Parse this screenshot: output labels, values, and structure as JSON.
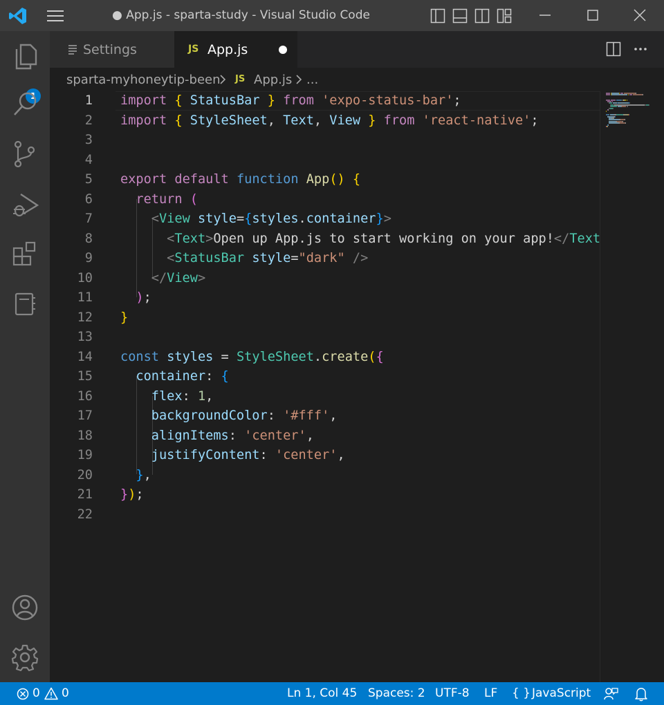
{
  "window": {
    "title": "● App.js - sparta-study - Visual Studio Code"
  },
  "activity_bar": {
    "explorer_badge": "1",
    "items": [
      "explorer",
      "search",
      "source-control",
      "run-debug",
      "extensions",
      "notebook"
    ],
    "bottom_items": [
      "accounts",
      "manage"
    ]
  },
  "tabs": [
    {
      "label": "Settings",
      "icon": "settings-file-icon",
      "active": false
    },
    {
      "label": "App.js",
      "icon": "JS",
      "active": true,
      "dirty": true
    }
  ],
  "breadcrumb": {
    "folder": "sparta-myhoneytip-been",
    "file_icon": "JS",
    "file": "App.js",
    "symbol": "..."
  },
  "editor": {
    "active_line": 1,
    "lines": [
      [
        [
          "import",
          "kw-pink"
        ],
        [
          " ",
          "pl"
        ],
        [
          "{",
          "b1"
        ],
        [
          " StatusBar ",
          "var"
        ],
        [
          "}",
          "b1"
        ],
        [
          " ",
          "pl"
        ],
        [
          "from",
          "kw-pink"
        ],
        [
          " ",
          "pl"
        ],
        [
          "'expo-status-bar'",
          "str"
        ],
        [
          ";",
          "pl"
        ]
      ],
      [
        [
          "import",
          "kw-pink"
        ],
        [
          " ",
          "pl"
        ],
        [
          "{",
          "b1"
        ],
        [
          " StyleSheet",
          "var"
        ],
        [
          ", ",
          "pl"
        ],
        [
          "Text",
          "var"
        ],
        [
          ", ",
          "pl"
        ],
        [
          "View",
          "var"
        ],
        [
          " ",
          "pl"
        ],
        [
          "}",
          "b1"
        ],
        [
          " ",
          "pl"
        ],
        [
          "from",
          "kw-pink"
        ],
        [
          " ",
          "pl"
        ],
        [
          "'react-native'",
          "str"
        ],
        [
          ";",
          "pl"
        ]
      ],
      [],
      [],
      [
        [
          "export",
          "kw-pink"
        ],
        [
          " ",
          "pl"
        ],
        [
          "default",
          "kw-pink"
        ],
        [
          " ",
          "pl"
        ],
        [
          "function",
          "kw-blue"
        ],
        [
          " ",
          "pl"
        ],
        [
          "App",
          "fn"
        ],
        [
          "()",
          "b1"
        ],
        [
          " ",
          "pl"
        ],
        [
          "{",
          "b1"
        ]
      ],
      [
        [
          "  ",
          "pl"
        ],
        [
          "return",
          "kw-pink"
        ],
        [
          " ",
          "pl"
        ],
        [
          "(",
          "b2"
        ]
      ],
      [
        [
          "    ",
          "pl"
        ],
        [
          "<",
          "tagp"
        ],
        [
          "View",
          "cls"
        ],
        [
          " ",
          "pl"
        ],
        [
          "style",
          "var"
        ],
        [
          "=",
          "pl"
        ],
        [
          "{",
          "b3"
        ],
        [
          "styles",
          "var"
        ],
        [
          ".",
          "pl"
        ],
        [
          "container",
          "var"
        ],
        [
          "}",
          "b3"
        ],
        [
          ">",
          "tagp"
        ]
      ],
      [
        [
          "      ",
          "pl"
        ],
        [
          "<",
          "tagp"
        ],
        [
          "Text",
          "cls"
        ],
        [
          ">",
          "tagp"
        ],
        [
          "Open up App.js to start working on your app!",
          "pl"
        ],
        [
          "</",
          "tagp"
        ],
        [
          "Text",
          "cls"
        ],
        [
          ">",
          "tagp"
        ]
      ],
      [
        [
          "      ",
          "pl"
        ],
        [
          "<",
          "tagp"
        ],
        [
          "StatusBar",
          "cls"
        ],
        [
          " ",
          "pl"
        ],
        [
          "style",
          "var"
        ],
        [
          "=",
          "pl"
        ],
        [
          "\"dark\"",
          "str"
        ],
        [
          " ",
          "pl"
        ],
        [
          "/>",
          "tagp"
        ]
      ],
      [
        [
          "    ",
          "pl"
        ],
        [
          "</",
          "tagp"
        ],
        [
          "View",
          "cls"
        ],
        [
          ">",
          "tagp"
        ]
      ],
      [
        [
          "  ",
          "pl"
        ],
        [
          ")",
          "b2"
        ],
        [
          ";",
          "pl"
        ]
      ],
      [
        [
          "}",
          "b1"
        ]
      ],
      [],
      [
        [
          "const",
          "kw-blue"
        ],
        [
          " ",
          "pl"
        ],
        [
          "styles",
          "var"
        ],
        [
          " = ",
          "pl"
        ],
        [
          "StyleSheet",
          "cls"
        ],
        [
          ".",
          "pl"
        ],
        [
          "create",
          "fn"
        ],
        [
          "(",
          "b1"
        ],
        [
          "{",
          "b2"
        ]
      ],
      [
        [
          "  ",
          "pl"
        ],
        [
          "container",
          "var"
        ],
        [
          ": ",
          "pl"
        ],
        [
          "{",
          "b3"
        ]
      ],
      [
        [
          "    ",
          "pl"
        ],
        [
          "flex",
          "var"
        ],
        [
          ": ",
          "pl"
        ],
        [
          "1",
          "num"
        ],
        [
          ",",
          "pl"
        ]
      ],
      [
        [
          "    ",
          "pl"
        ],
        [
          "backgroundColor",
          "var"
        ],
        [
          ": ",
          "pl"
        ],
        [
          "'#fff'",
          "str"
        ],
        [
          ",",
          "pl"
        ]
      ],
      [
        [
          "    ",
          "pl"
        ],
        [
          "alignItems",
          "var"
        ],
        [
          ": ",
          "pl"
        ],
        [
          "'center'",
          "str"
        ],
        [
          ",",
          "pl"
        ]
      ],
      [
        [
          "    ",
          "pl"
        ],
        [
          "justifyContent",
          "var"
        ],
        [
          ": ",
          "pl"
        ],
        [
          "'center'",
          "str"
        ],
        [
          ",",
          "pl"
        ]
      ],
      [
        [
          "  ",
          "pl"
        ],
        [
          "}",
          "b3"
        ],
        [
          ",",
          "pl"
        ]
      ],
      [
        [
          "}",
          "b2"
        ],
        [
          ")",
          "b1"
        ],
        [
          ";",
          "pl"
        ]
      ],
      []
    ]
  },
  "status_bar": {
    "errors": "0",
    "warnings": "0",
    "position": "Ln 1, Col 45",
    "indent": "Spaces: 2",
    "encoding": "UTF-8",
    "eol": "LF",
    "language_icon": "{ }",
    "language": "JavaScript"
  },
  "colors": {
    "accent": "#007acc",
    "titlebar": "#3c3c3c",
    "activitybar": "#333333",
    "editor_bg": "#1e1e1e"
  }
}
